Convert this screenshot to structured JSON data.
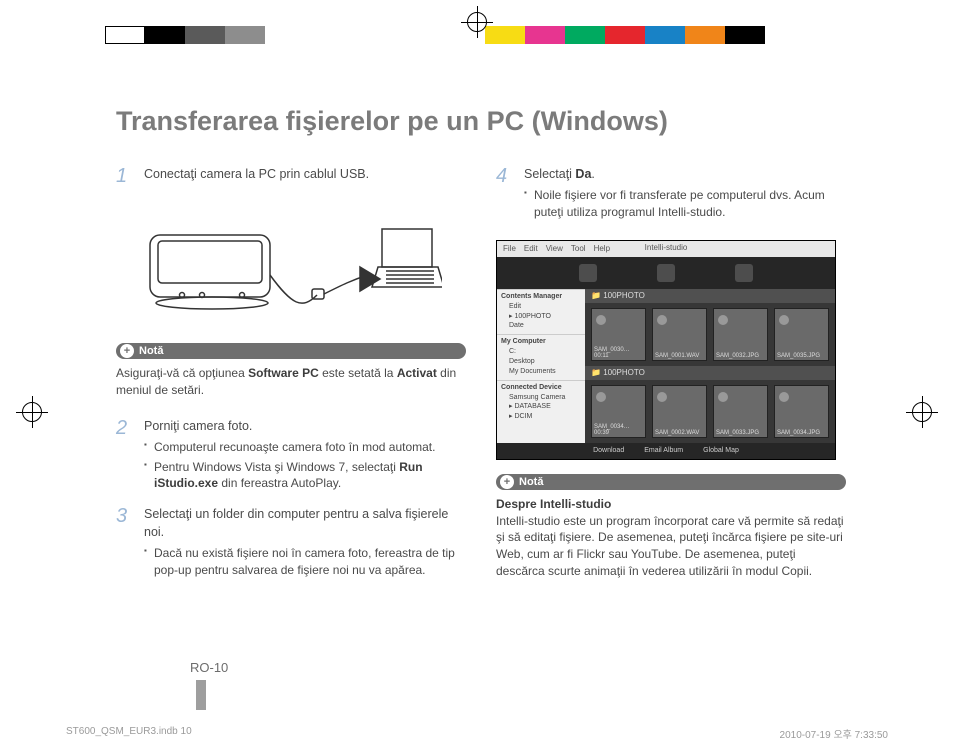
{
  "title": "Transferarea fişierelor pe un PC (Windows)",
  "steps": {
    "s1": {
      "num": "1",
      "text": "Conectaţi camera la PC prin cablul USB."
    },
    "s2": {
      "num": "2",
      "text": "Porniţi camera foto.",
      "b1": "Computerul recunoaşte camera foto în mod automat.",
      "b2_pre": "Pentru Windows Vista şi Windows 7, selectaţi ",
      "b2_bold": "Run iStudio.exe",
      "b2_post": " din fereastra AutoPlay."
    },
    "s3": {
      "num": "3",
      "text": "Selectaţi un folder din computer pentru a salva fişierele noi.",
      "b1": "Dacă nu există fişiere noi în camera foto, fereastra de tip pop-up pentru salvarea de fişiere noi nu va apărea."
    },
    "s4": {
      "num": "4",
      "text_pre": "Selectaţi ",
      "text_bold": "Da",
      "text_post": ".",
      "b1": "Noile fişiere vor fi transferate pe computerul dvs. Acum puteţi utiliza programul Intelli-studio."
    }
  },
  "note_label": "Notă",
  "note1_pre": "Asiguraţi-vă că opţiunea ",
  "note1_bold1": "Software PC",
  "note1_mid": " este setată la ",
  "note1_bold2": "Activat",
  "note1_post": " din meniul de setări.",
  "note2_title": "Despre Intelli-studio",
  "note2_text": "Intelli-studio este un program încorporat care vă permite să redaţi şi să editaţi fişiere. De asemenea, puteţi încărca fişiere pe site-uri Web, cum ar fi Flickr sau YouTube. De asemenea, puteţi descărca scurte animaţii în vederea utilizării în modul Copii.",
  "app": {
    "menu": {
      "file": "File",
      "edit": "Edit",
      "view": "View",
      "tool": "Tool",
      "help": "Help"
    },
    "title": "Intelli-studio",
    "sidebar": {
      "cm": "Contents Manager",
      "edit": "Edit",
      "photo": "100PHOTO",
      "date": "Date",
      "mycomp": "My Computer",
      "c": "C:",
      "desktop": "Desktop",
      "mydoc": "My Documents",
      "conn": "Connected Device",
      "camera": "Samsung Camera",
      "db": "DATABASE",
      "dcim": "DCIM"
    },
    "folder": "100PHOTO",
    "thumbs": {
      "t1": "SAM_0030… 00:11",
      "t2": "SAM_0001.WAV",
      "t3": "SAM_0032.JPG",
      "t4": "SAM_0035.JPG",
      "t5": "SAM_0034… 00:39",
      "t6": "SAM_0002.WAV",
      "t7": "SAM_0033.JPG",
      "t8": "SAM_0034.JPG"
    },
    "footer": {
      "dl": "Download",
      "em": "Email Album",
      "gm": "Global Map"
    }
  },
  "pagenum": "RO-10",
  "footer_left": "ST600_QSM_EUR3.indb   10",
  "footer_right": "2010-07-19   오후 7:33:50"
}
